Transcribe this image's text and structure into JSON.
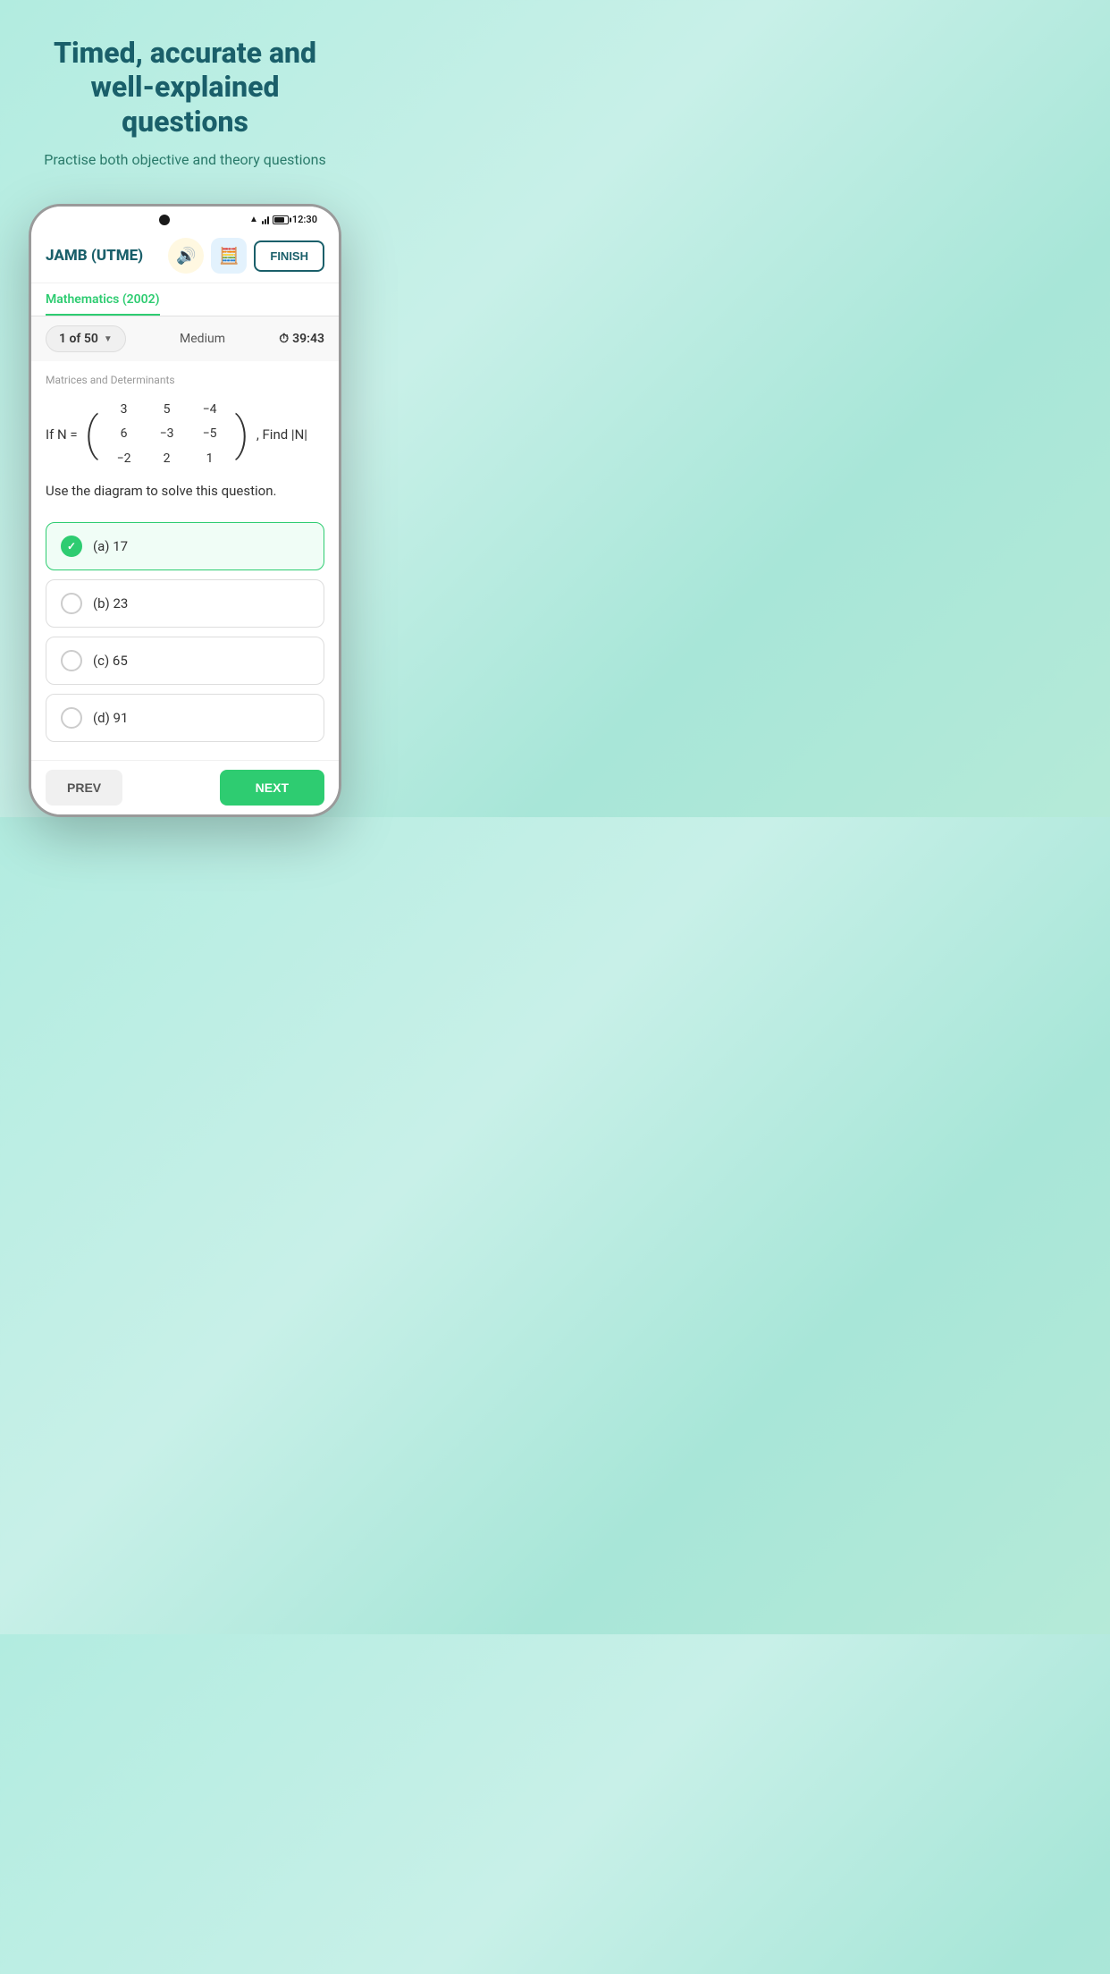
{
  "hero": {
    "title": "Timed, accurate and well-explained questions",
    "subtitle": "Practise both objective and theory questions"
  },
  "status_bar": {
    "time": "12:30"
  },
  "header": {
    "app_title": "JAMB (UTME)",
    "sound_icon": "🔊",
    "calculator_icon": "🧮",
    "finish_label": "FINISH"
  },
  "subject_tab": {
    "label": "Mathematics (2002)"
  },
  "question_meta": {
    "question_number": "1 of 50",
    "difficulty": "Medium",
    "timer": "39:43"
  },
  "question": {
    "topic": "Matrices and Determinants",
    "matrix_label": "If N =",
    "matrix_rows": [
      [
        "3",
        "5",
        "−4"
      ],
      [
        "6",
        "−3",
        "−5"
      ],
      [
        "−2",
        "2",
        "1"
      ]
    ],
    "find_label": ", Find |N|",
    "instruction": "Use the diagram to solve this question.",
    "options": [
      {
        "id": "a",
        "label": "(a) 17",
        "selected": true
      },
      {
        "id": "b",
        "label": "(b) 23",
        "selected": false
      },
      {
        "id": "c",
        "label": "(c) 65",
        "selected": false
      },
      {
        "id": "d",
        "label": "(d) 91",
        "selected": false
      }
    ]
  },
  "navigation": {
    "prev_label": "PREV",
    "next_label": "NEXT"
  },
  "colors": {
    "primary": "#1a5f6a",
    "accent": "#2ecc71",
    "bg_gradient_start": "#b2ece0",
    "bg_gradient_end": "#a8e6d8"
  }
}
